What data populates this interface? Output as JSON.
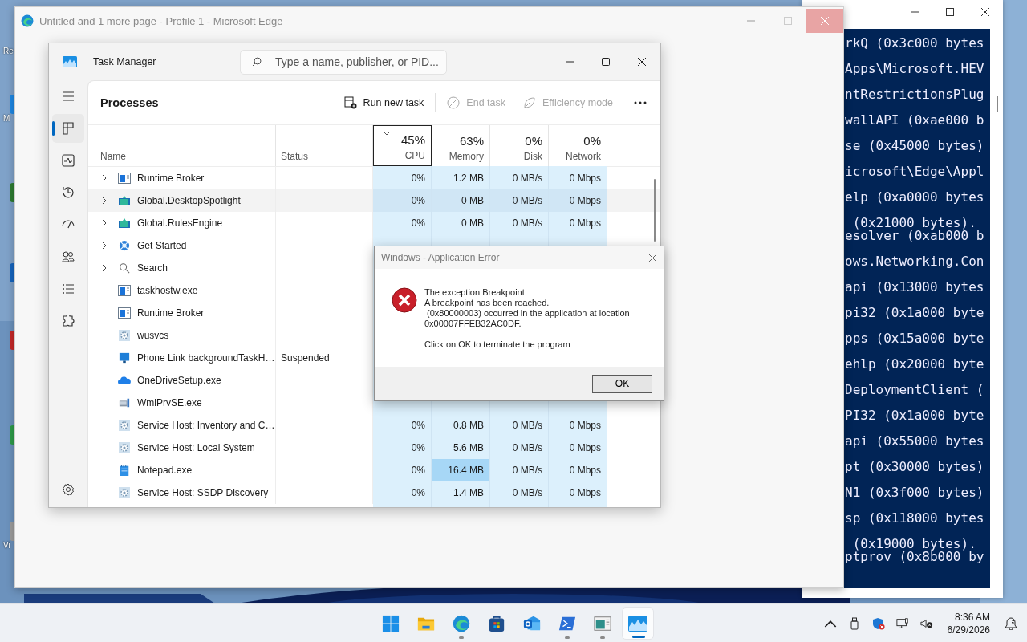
{
  "desktop_icons": [
    {
      "kind": "label-only",
      "label": "Re"
    },
    {
      "kind": "icon",
      "color": "#1e88e5",
      "label": "M"
    },
    {
      "kind": "icon",
      "color": "#2e7d32"
    },
    {
      "kind": "icon",
      "color": "#1565c0"
    },
    {
      "kind": "icon",
      "color": "#c62828"
    },
    {
      "kind": "icon",
      "color": "#2e9d4a"
    },
    {
      "kind": "icon",
      "color": "#9e9e9e",
      "label": "Vi"
    }
  ],
  "console": {
    "lines": [
      {
        "kind": "entry",
        "text": "rkQ (0x3c000 bytes"
      },
      {
        "kind": "entry",
        "text": "Apps\\Microsoft.HEV"
      },
      {
        "kind": "entry",
        "text": "ntRestrictionsPlug"
      },
      {
        "kind": "entry",
        "text": "wallAPI (0xae000 b"
      },
      {
        "kind": "entry",
        "text": "se (0x45000 bytes)"
      },
      {
        "kind": "entry",
        "text": "icrosoft\\Edge\\Appl"
      },
      {
        "kind": "entry",
        "text": "elp (0xa0000 bytes"
      },
      {
        "kind": "entry",
        "text": " (0x21000 bytes)."
      },
      {
        "kind": "follow",
        "text": "esolver (0xab000 b"
      },
      {
        "kind": "entry",
        "text": "ows.Networking.Con"
      },
      {
        "kind": "entry",
        "text": "api (0x13000 bytes"
      },
      {
        "kind": "entry",
        "text": "pi32 (0x1a000 byte"
      },
      {
        "kind": "entry",
        "text": "pps (0x15a000 byte"
      },
      {
        "kind": "entry",
        "text": "ehlp (0x20000 byte"
      },
      {
        "kind": "entry",
        "text": "DeploymentClient ("
      },
      {
        "kind": "entry",
        "text": "PI32 (0x1a000 byte"
      },
      {
        "kind": "entry",
        "text": "api (0x55000 bytes"
      },
      {
        "kind": "entry",
        "text": "pt (0x30000 bytes)"
      },
      {
        "kind": "entry",
        "text": "N1 (0x3f000 bytes)"
      },
      {
        "kind": "entry",
        "text": "sp (0x118000 bytes"
      },
      {
        "kind": "entry",
        "text": " (0x19000 bytes)."
      },
      {
        "kind": "follow",
        "text": "ptprov (0x8b000 by"
      }
    ]
  },
  "edge": {
    "title": "Untitled and 1 more page - Profile 1 - Microsoft Edge",
    "close_highlighted": true
  },
  "task_manager": {
    "title": "Task Manager",
    "search": {
      "placeholder": "Type a name, publisher, or PID..."
    },
    "nav": [
      {
        "kind": "menu",
        "selected": false
      },
      {
        "kind": "processes",
        "selected": true
      },
      {
        "kind": "performance",
        "selected": false
      },
      {
        "kind": "history",
        "selected": false
      },
      {
        "kind": "startup",
        "selected": false
      },
      {
        "kind": "users",
        "selected": false
      },
      {
        "kind": "details",
        "selected": false
      },
      {
        "kind": "services",
        "selected": false
      }
    ],
    "page_title": "Processes",
    "actions": [
      {
        "kind": "run",
        "label": "Run new task",
        "disabled": false
      },
      {
        "kind": "end",
        "label": "End task",
        "disabled": true
      },
      {
        "kind": "efficiency",
        "label": "Efficiency mode",
        "disabled": true
      }
    ],
    "columns": [
      {
        "kind": "text",
        "label": "Name"
      },
      {
        "kind": "text",
        "label": "Status"
      },
      {
        "kind": "metric",
        "total": "45%",
        "label": "CPU",
        "sorted": true
      },
      {
        "kind": "metric",
        "total": "63%",
        "label": "Memory",
        "sorted": false
      },
      {
        "kind": "metric",
        "total": "0%",
        "label": "Disk",
        "sorted": false
      },
      {
        "kind": "metric",
        "total": "0%",
        "label": "Network",
        "sorted": false
      }
    ],
    "rows": [
      {
        "name": "Runtime Broker",
        "kind": "window",
        "expandable": true,
        "hovered": false,
        "memory_high": false,
        "values": [
          "0%",
          "1.2 MB",
          "0 MB/s",
          "0 Mbps"
        ]
      },
      {
        "name": "Global.DesktopSpotlight",
        "kind": "package",
        "expandable": true,
        "hovered": true,
        "memory_high": false,
        "values": [
          "0%",
          "0 MB",
          "0 MB/s",
          "0 Mbps"
        ]
      },
      {
        "name": "Global.RulesEngine",
        "kind": "package",
        "expandable": true,
        "hovered": false,
        "memory_high": false,
        "values": [
          "0%",
          "0 MB",
          "0 MB/s",
          "0 Mbps"
        ]
      },
      {
        "name": "Get Started",
        "kind": "globe",
        "expandable": true,
        "hovered": false
      },
      {
        "name": "Search",
        "kind": "search",
        "expandable": true,
        "hovered": false
      },
      {
        "name": "taskhostw.exe",
        "kind": "window",
        "expandable": false,
        "hovered": false
      },
      {
        "name": "Runtime Broker",
        "kind": "window",
        "expandable": false,
        "hovered": false
      },
      {
        "name": "wusvcs",
        "kind": "gear",
        "expandable": false,
        "hovered": false
      },
      {
        "name": "Phone Link backgroundTaskH…",
        "kind": "monitor",
        "expandable": false,
        "hovered": false,
        "status": "Suspended"
      },
      {
        "name": "OneDriveSetup.exe",
        "kind": "cloud",
        "expandable": false,
        "hovered": false
      },
      {
        "name": "WmiPrvSE.exe",
        "kind": "wmi",
        "expandable": false,
        "hovered": false
      },
      {
        "name": "Service Host: Inventory and C…",
        "kind": "gear",
        "expandable": false,
        "hovered": false,
        "memory_high": false,
        "values": [
          "0%",
          "0.8 MB",
          "0 MB/s",
          "0 Mbps"
        ]
      },
      {
        "name": "Service Host: Local System",
        "kind": "gear",
        "expandable": false,
        "hovered": false,
        "memory_high": false,
        "values": [
          "0%",
          "5.6 MB",
          "0 MB/s",
          "0 Mbps"
        ]
      },
      {
        "name": "Notepad.exe",
        "kind": "notepad",
        "expandable": false,
        "hovered": false,
        "memory_high": true,
        "values": [
          "0%",
          "16.4 MB",
          "0 MB/s",
          "0 Mbps"
        ]
      },
      {
        "name": "Service Host: SSDP Discovery",
        "kind": "gear",
        "expandable": false,
        "hovered": false,
        "memory_high": false,
        "values": [
          "0%",
          "1.4 MB",
          "0 MB/s",
          "0 Mbps"
        ]
      }
    ]
  },
  "dialog": {
    "title": "Windows - Application Error",
    "message": "The exception Breakpoint\nA breakpoint has been reached.\n (0x80000003) occurred in the application at location\n0x00007FFEB32AC0DF.",
    "instruction": "Click on OK to terminate the program",
    "button": "OK"
  },
  "taskbar": {
    "apps": [
      {
        "kind": "start",
        "running": false,
        "active": false
      },
      {
        "kind": "folder",
        "running": false,
        "active": false
      },
      {
        "kind": "edge",
        "running": true,
        "active": false
      },
      {
        "kind": "store",
        "running": false,
        "active": false
      },
      {
        "kind": "outlook",
        "running": false,
        "active": false
      },
      {
        "kind": "terminal",
        "running": true,
        "active": false
      },
      {
        "kind": "app",
        "running": true,
        "active": false
      },
      {
        "kind": "taskmgr",
        "running": true,
        "active": true
      }
    ],
    "tray": [
      {
        "kind": "chevron"
      },
      {
        "kind": "usb"
      },
      {
        "kind": "shield"
      },
      {
        "kind": "network"
      },
      {
        "kind": "mute"
      }
    ],
    "time": "8:36 AM",
    "date": "6/29/2026"
  }
}
